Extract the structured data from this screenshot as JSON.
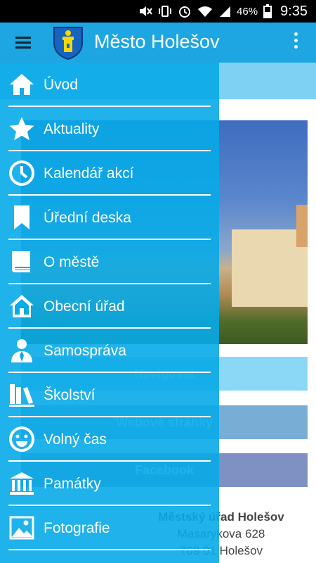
{
  "status_bar": {
    "battery_percent": "46%",
    "time": "9:35",
    "icons": [
      "mute-icon",
      "vibrate-icon",
      "alarm-icon",
      "wifi-icon",
      "signal-icon",
      "battery-icon"
    ]
  },
  "app_bar": {
    "title": "Město Holešov",
    "menu_icon": "hamburger-menu-icon",
    "logo": "town-crest-logo",
    "overflow_icon": "overflow-menu-icon"
  },
  "drawer": {
    "items": [
      {
        "label": "Úvod",
        "icon": "home-icon"
      },
      {
        "label": "Aktuality",
        "icon": "star-icon"
      },
      {
        "label": "Kalendář akcí",
        "icon": "clock-icon"
      },
      {
        "label": "Úřední deska",
        "icon": "bookmark-icon"
      },
      {
        "label": "O městě",
        "icon": "book-icon"
      },
      {
        "label": "Obecní úřad",
        "icon": "building-home-icon"
      },
      {
        "label": "Samospráva",
        "icon": "person-icon"
      },
      {
        "label": "Školství",
        "icon": "books-icon"
      },
      {
        "label": "Volný čas",
        "icon": "smiley-icon"
      },
      {
        "label": "Památky",
        "icon": "monument-icon"
      },
      {
        "label": "Fotografie",
        "icon": "photo-icon"
      }
    ]
  },
  "content": {
    "buttons": {
      "navigate": "Navigovat",
      "website": "Webové stránky",
      "facebook": "Facebook"
    },
    "address": {
      "name": "Městský úřad Holešov",
      "street": "Masarykova 628",
      "city": "769 01 Holešov"
    }
  },
  "colors": {
    "app_bar": "#1ea6e3",
    "drawer": "#08aae8",
    "status_bar": "#000000"
  }
}
